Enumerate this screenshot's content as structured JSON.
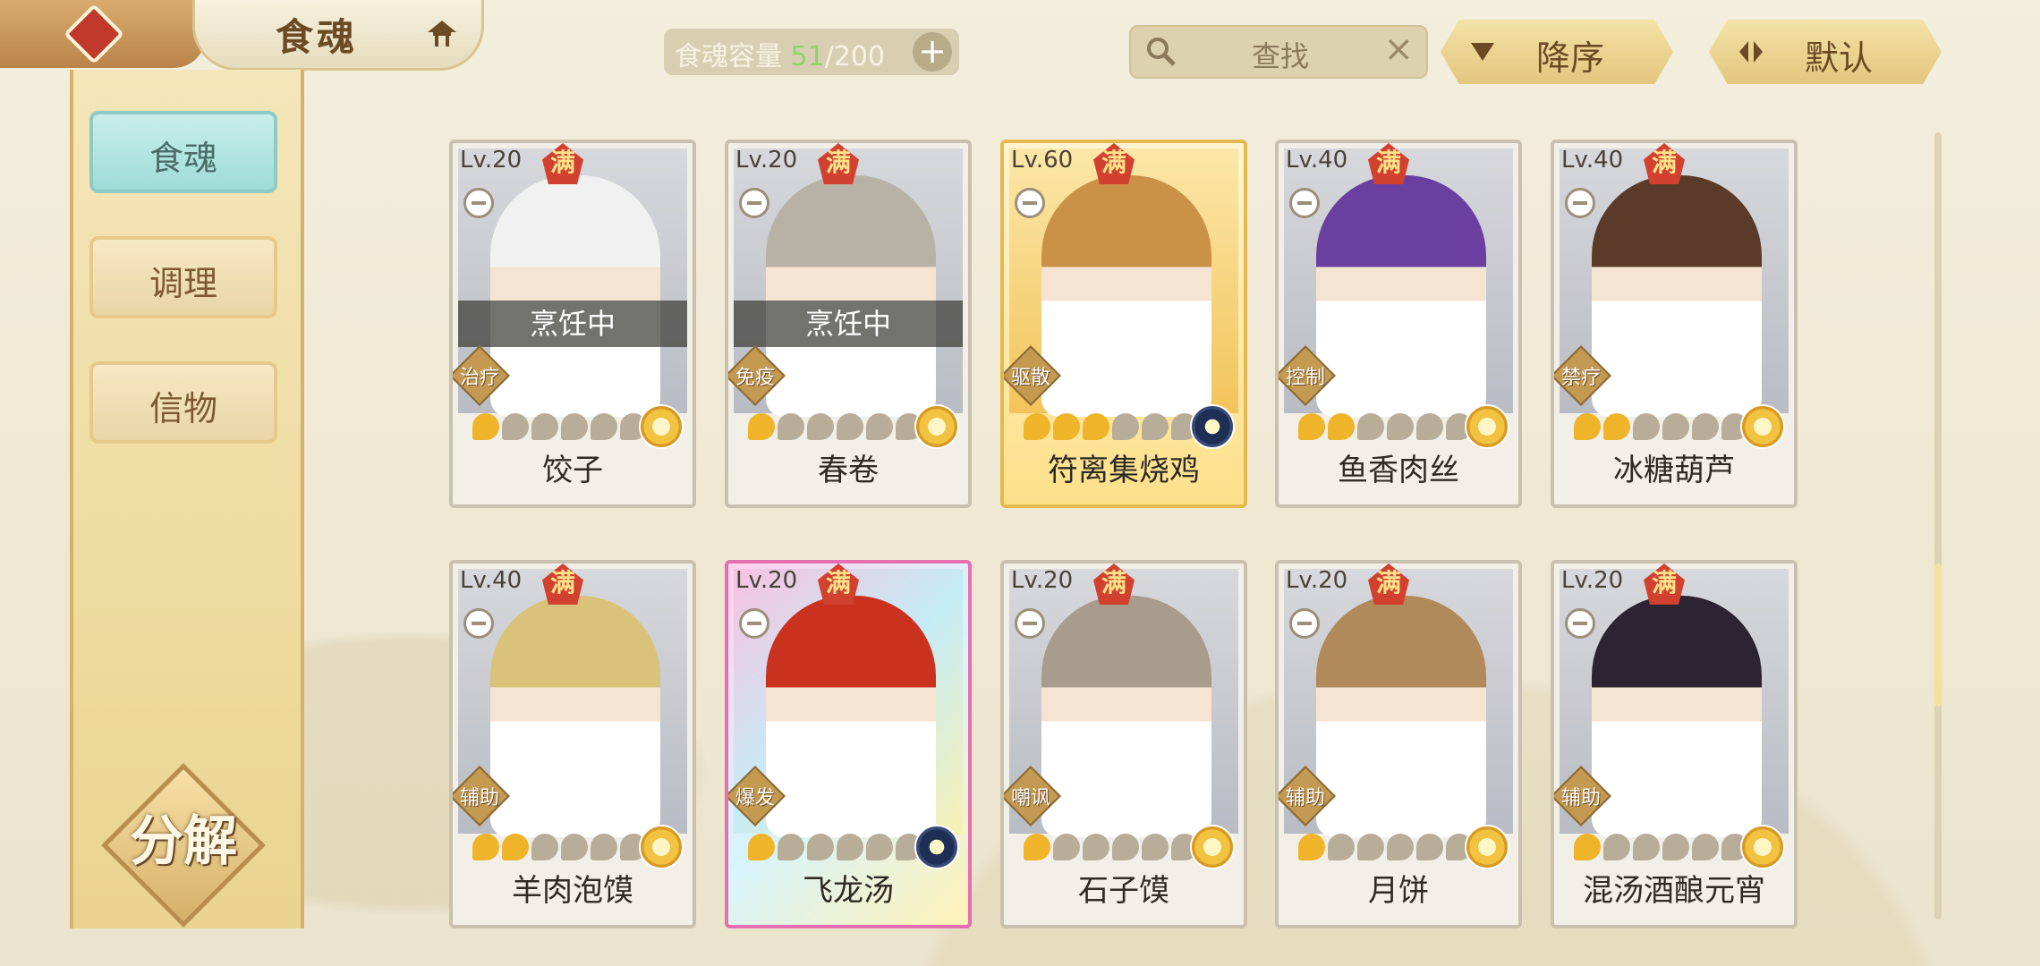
{
  "header": {
    "title": "食魂",
    "capacity_label": "食魂容量 ",
    "capacity_current": "51",
    "capacity_max": "/200",
    "plus_label": "+",
    "search_placeholder": "查找",
    "search_clear": "×",
    "sort_order_label": "降序",
    "sort_mode_label": "默认"
  },
  "sidebar": {
    "tabs": [
      {
        "label": "食魂",
        "active": true
      },
      {
        "label": "调理",
        "active": false
      },
      {
        "label": "信物",
        "active": false
      }
    ],
    "decompose_label": "分解"
  },
  "cards": [
    {
      "level": "Lv.20",
      "badge": "满",
      "role": "治疗",
      "status": "烹饪中",
      "stars_on": 1,
      "stars_total": 6,
      "name": "饺子",
      "style": "normal",
      "flower": "gold",
      "hair": "#f1f1f1"
    },
    {
      "level": "Lv.20",
      "badge": "满",
      "role": "免疫",
      "status": "烹饪中",
      "stars_on": 1,
      "stars_total": 6,
      "name": "春卷",
      "style": "normal",
      "flower": "gold",
      "hair": "#b8b2a6"
    },
    {
      "level": "Lv.60",
      "badge": "满",
      "role": "驱散",
      "status": "",
      "stars_on": 3,
      "stars_total": 6,
      "name": "符离集烧鸡",
      "style": "gold",
      "flower": "blue",
      "hair": "#c99248"
    },
    {
      "level": "Lv.40",
      "badge": "满",
      "role": "控制",
      "status": "",
      "stars_on": 2,
      "stars_total": 6,
      "name": "鱼香肉丝",
      "style": "normal",
      "flower": "gold",
      "hair": "#6a3fa0"
    },
    {
      "level": "Lv.40",
      "badge": "满",
      "role": "禁疗",
      "status": "",
      "stars_on": 2,
      "stars_total": 6,
      "name": "冰糖葫芦",
      "style": "normal",
      "flower": "gold",
      "hair": "#5a3b2a"
    },
    {
      "level": "Lv.40",
      "badge": "满",
      "role": "辅助",
      "status": "",
      "stars_on": 2,
      "stars_total": 6,
      "name": "羊肉泡馍",
      "style": "normal",
      "flower": "gold",
      "hair": "#d9c37a"
    },
    {
      "level": "Lv.20",
      "badge": "满",
      "role": "爆发",
      "status": "",
      "stars_on": 1,
      "stars_total": 6,
      "name": "飞龙汤",
      "style": "rainbow",
      "flower": "blue",
      "hair": "#c9321f"
    },
    {
      "level": "Lv.20",
      "badge": "满",
      "role": "嘲讽",
      "status": "",
      "stars_on": 1,
      "stars_total": 6,
      "name": "石子馍",
      "style": "normal",
      "flower": "gold",
      "hair": "#a89c8c"
    },
    {
      "level": "Lv.20",
      "badge": "满",
      "role": "辅助",
      "status": "",
      "stars_on": 1,
      "stars_total": 6,
      "name": "月饼",
      "style": "normal",
      "flower": "gold",
      "hair": "#b08a5a"
    },
    {
      "level": "Lv.20",
      "badge": "满",
      "role": "辅助",
      "status": "",
      "stars_on": 1,
      "stars_total": 6,
      "name": "混汤酒酿元宵",
      "style": "normal",
      "flower": "gold",
      "hair": "#2a2530"
    }
  ]
}
